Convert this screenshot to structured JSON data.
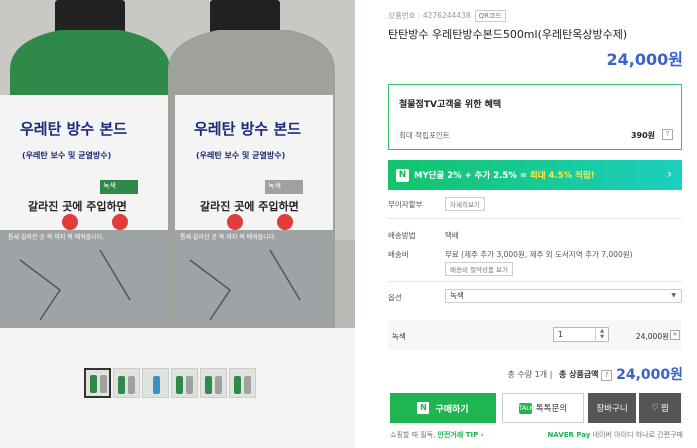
{
  "product": {
    "sku_label": "상품번호 : 4276244438",
    "qr_label": "QR코드",
    "title": "탄탄방수 우레탄방수본드500ml(우레탄옥상방수제)",
    "price": "24,000원",
    "bottle_text_1": "우레탄 방수 본드",
    "bottle_text_2": "(우레탄 보수 및 균열방수)",
    "bottle_color_badge": "녹색",
    "bottle_text_3": "갈라진 곳에 주입하면",
    "bottle_text_4": "틈새 갈라진 곳 쏙 까지 꽉 메워줍니다."
  },
  "benefit": {
    "title": "철물점TV고객을 위한 혜택",
    "points_label": "최대 적립포인트",
    "points_value": "390원"
  },
  "promo": {
    "badge": "N",
    "text_prefix": "MY단골 2% + 추가 2.5% = ",
    "text_highlight": "최대 4.5% 적립!",
    "chevron": "›"
  },
  "info": {
    "interest_free_label": "무이자할부",
    "interest_free_btn": "자세히보기",
    "shipping_method_label": "배송방법",
    "shipping_method_value": "택배",
    "shipping_fee_label": "배송비",
    "shipping_fee_value": "무료 (제주 추가 3,000원, 제주 외 도서지역 추가 7,000원)",
    "shipping_fee_btn": "배송비 절약상품 보기",
    "option_label": "옵션",
    "option_value": "녹색"
  },
  "selected_option": {
    "name": "녹색",
    "qty": "1",
    "price": "24,000원"
  },
  "total": {
    "qty_text": "총 수량 1개",
    "amount_label": "총 상품금액",
    "amount_value": "24,000원"
  },
  "buttons": {
    "buy": "구매하기",
    "talk": "톡톡문의",
    "cart": "장바구니",
    "wish": "찜"
  },
  "footer": {
    "left": "쇼핑할 때 필독, ",
    "left_link": "안전거래 TIP ›",
    "naver_pay": "NAVER Pay",
    "right": "네이버 아이디 하나로 간편구매"
  }
}
